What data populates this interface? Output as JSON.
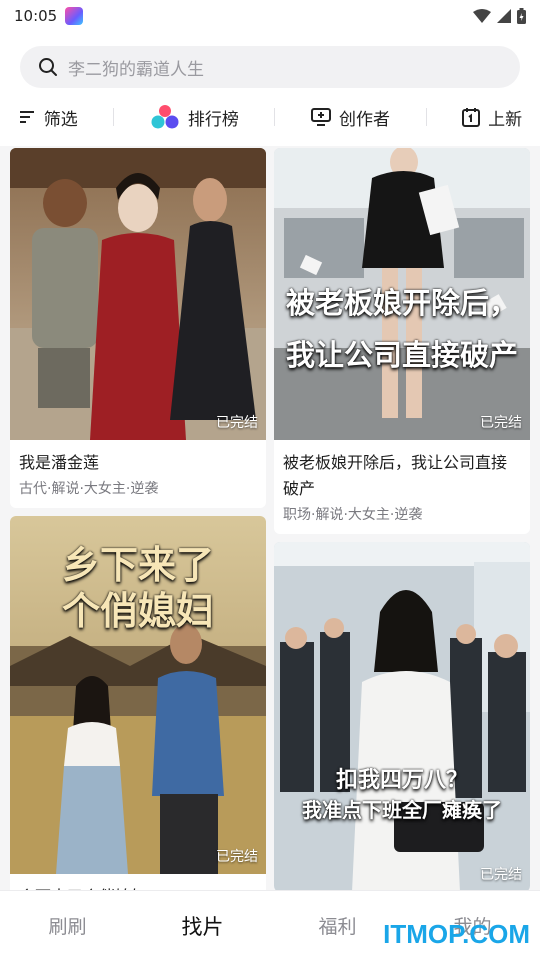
{
  "status_bar": {
    "time": "10:05"
  },
  "search": {
    "placeholder": "李二狗的霸道人生"
  },
  "filters": [
    {
      "label": "筛选",
      "icon": "filter-lines-icon"
    },
    {
      "label": "排行榜",
      "icon": "ranking-dots-icon"
    },
    {
      "label": "创作者",
      "icon": "creator-screen-icon"
    },
    {
      "label": "上新",
      "icon": "calendar-icon"
    }
  ],
  "cards": [
    {
      "title": "我是潘金莲",
      "tags": "古代·解说·大女主·逆袭",
      "status": "已完结"
    },
    {
      "title": "被老板娘开除后，我让公司直接破产",
      "tags": "职场·解说·大女主·逆袭",
      "status": "已完结",
      "poster_line1": "被老板娘开除后，",
      "poster_line2": "我让公司直接破产"
    },
    {
      "title": "乡下来了个俏媳妇",
      "tags": "",
      "status": "已完结",
      "poster_line1": "乡下来了",
      "poster_line2": "个俏媳妇"
    },
    {
      "title": "",
      "tags": "",
      "status": "已完结",
      "poster_line1": "扣我四万八？",
      "poster_line2": "我准点下班全厂瘫痪了"
    }
  ],
  "tabs": [
    {
      "label": "刷刷"
    },
    {
      "label": "找片",
      "active": true
    },
    {
      "label": "福利"
    },
    {
      "label": "我的"
    }
  ],
  "watermark": "ITMOP.COM",
  "colors": {
    "accent": "#1aa6e8",
    "page_bg": "#f5f5f6",
    "card_bg": "#ffffff"
  }
}
